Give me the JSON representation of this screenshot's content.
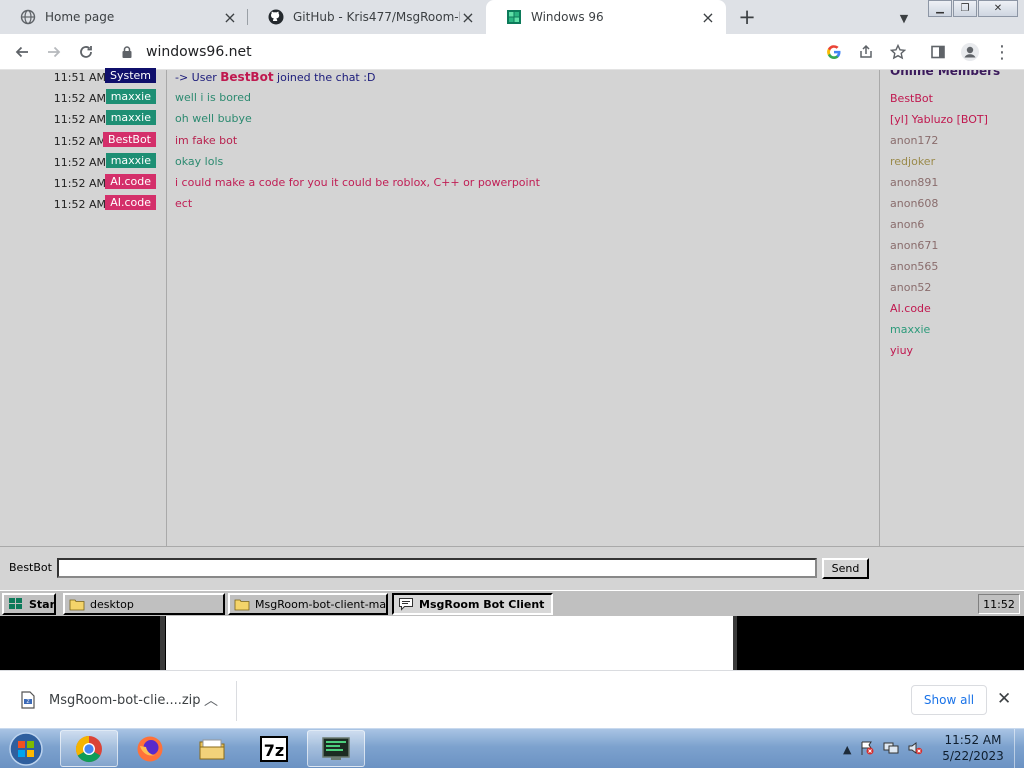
{
  "browser": {
    "tabs": [
      {
        "title": "Home page",
        "icon": "globe-icon",
        "active": false
      },
      {
        "title": "GitHub - Kris477/MsgRoom-bot-",
        "icon": "github-icon",
        "active": false
      },
      {
        "title": "Windows 96",
        "icon": "windows96-icon",
        "active": true
      }
    ],
    "url": "windows96.net"
  },
  "chat": {
    "messages": [
      {
        "time": "11:51 AM",
        "user": "System",
        "user_color": "#0f0f6b",
        "prefix": "-> User ",
        "bold": "BestBot",
        "text": " joined the chat :D",
        "text_color": "#1a1a7a"
      },
      {
        "time": "11:52 AM",
        "user": "maxxie",
        "user_color": "#1e8f74",
        "text": "well i is bored",
        "text_color": "#2c8a70"
      },
      {
        "time": "11:52 AM",
        "user": "maxxie",
        "user_color": "#1e8f74",
        "text": "oh well bubye",
        "text_color": "#2c8a70"
      },
      {
        "time": "11:52 AM",
        "user": "BestBot",
        "user_color": "#d42f6a",
        "text": "im fake  bot",
        "text_color": "#b8224f"
      },
      {
        "time": "11:52 AM",
        "user": "maxxie",
        "user_color": "#1e8f74",
        "text": "okay lols",
        "text_color": "#2c8a70"
      },
      {
        "time": "11:52 AM",
        "user": "AI.code",
        "user_color": "#d42f6a",
        "text": "i could make a code for you it could be roblox, C++ or powerpoint",
        "text_color": "#c01d54"
      },
      {
        "time": "11:52 AM",
        "user": "AI.code",
        "user_color": "#d42f6a",
        "text": "ect",
        "text_color": "#c01d54"
      }
    ],
    "members_header": "Online Members",
    "members": [
      {
        "name": "BestBot",
        "color": "#c0184f"
      },
      {
        "name": "[yl] Yabluzo [BOT]",
        "color": "#c0184f"
      },
      {
        "name": "anon172",
        "color": "#8a6d6d"
      },
      {
        "name": "redjoker",
        "color": "#9a8a4a"
      },
      {
        "name": "anon891",
        "color": "#8a6d6d"
      },
      {
        "name": "anon608",
        "color": "#8a6d6d"
      },
      {
        "name": "anon6",
        "color": "#8a6d6d"
      },
      {
        "name": "anon671",
        "color": "#8a6d6d"
      },
      {
        "name": "anon565",
        "color": "#8a6d6d"
      },
      {
        "name": "anon52",
        "color": "#8a6d6d"
      },
      {
        "name": "AI.code",
        "color": "#c0184f"
      },
      {
        "name": "maxxie",
        "color": "#2c9a7a"
      },
      {
        "name": "yiuy",
        "color": "#c0184f"
      }
    ],
    "nickname": "BestBot",
    "input_value": "",
    "send_label": "Send"
  },
  "w96_taskbar": {
    "start_label": "Start",
    "items": [
      {
        "label": "desktop",
        "pressed": false
      },
      {
        "label": "MsgRoom-bot-client-main",
        "pressed": false
      },
      {
        "label": "MsgRoom Bot Client",
        "pressed": true
      }
    ],
    "clock": "11:52"
  },
  "downloads": {
    "file": "MsgRoom-bot-clie....zip",
    "show_all": "Show all"
  },
  "win7_taskbar": {
    "apps": [
      "chrome-icon",
      "firefox-icon",
      "explorer-folder-icon",
      "7zip-icon",
      "terminal-icon"
    ],
    "time": "11:52 AM",
    "date": "5/22/2023"
  }
}
